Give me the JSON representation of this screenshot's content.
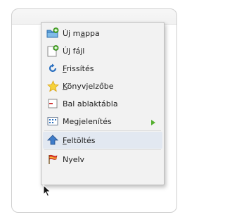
{
  "menu": {
    "items": [
      {
        "label_pre": "Új m",
        "label_ul": "a",
        "label_post": "ppa",
        "icon": "new-folder-icon"
      },
      {
        "label_pre": "Új fájl",
        "label_ul": "",
        "label_post": "",
        "icon": "new-file-icon"
      },
      {
        "label_pre": "",
        "label_ul": "F",
        "label_post": "rissítés",
        "icon": "refresh-icon"
      },
      {
        "label_pre": "",
        "label_ul": "K",
        "label_post": "önyvjelzőbe",
        "icon": "bookmark-star-icon"
      },
      {
        "label_pre": "Bal ablaktábla",
        "label_ul": "",
        "label_post": "",
        "icon": "left-pane-icon"
      },
      {
        "label_pre": "Megjelenítés",
        "label_ul": "",
        "label_post": "",
        "icon": "view-icon",
        "submenu": true
      },
      {
        "label_pre": "",
        "label_ul": "F",
        "label_post": "eltöltés",
        "icon": "upload-arrow-icon"
      },
      {
        "label_pre": "Nyelv",
        "label_ul": "",
        "label_post": "",
        "icon": "language-icon"
      }
    ]
  },
  "colors": {
    "accent_green": "#4caf28",
    "accent_blue": "#2a6fbf",
    "submenu_arrow": "#55b030"
  }
}
